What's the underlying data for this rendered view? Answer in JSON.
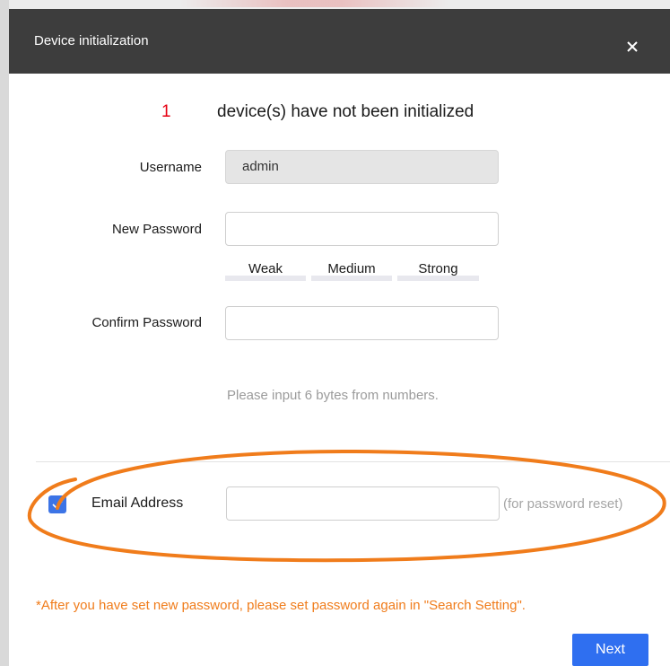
{
  "dialog": {
    "title": "Device initialization",
    "close_icon": "close-icon"
  },
  "status": {
    "count": "1",
    "text": "device(s) have not been initialized",
    "count_color": "#e60012"
  },
  "form": {
    "username": {
      "label": "Username",
      "value": "admin"
    },
    "new_password": {
      "label": "New Password",
      "value": ""
    },
    "strength": {
      "weak": "Weak",
      "medium": "Medium",
      "strong": "Strong"
    },
    "confirm_password": {
      "label": "Confirm Password",
      "value": ""
    },
    "hint": "Please input 6 bytes from numbers."
  },
  "email": {
    "checked": true,
    "checkbox_icon": "checkmark-icon",
    "label": "Email Address",
    "value": "",
    "hint": "(for password reset)"
  },
  "warning": "*After you have set new password, please set password again in \"Search Setting\".",
  "footer": {
    "next_label": "Next"
  },
  "colors": {
    "title_bar": "#3d3d3d",
    "primary": "#2f6ff0",
    "warning": "#f07c1b",
    "annotation": "#f07c1b"
  }
}
